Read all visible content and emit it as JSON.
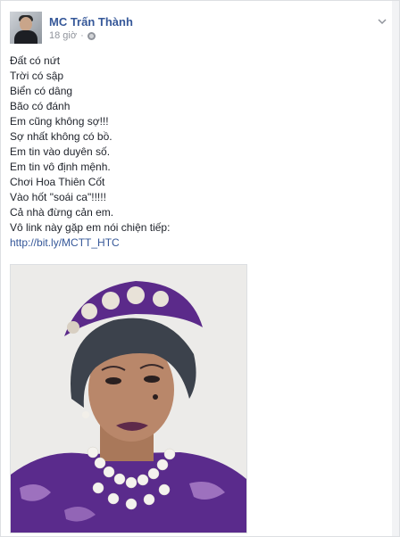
{
  "post": {
    "author": "MC Trấn Thành",
    "time": "18 giờ",
    "separator": "·",
    "lines": [
      "Đất có nứt",
      "Trời có sập",
      "Biển có dâng",
      "Bão có đánh",
      "Em cũng không sợ!!!",
      "Sợ nhất không có bồ.",
      "Em tin vào duyên số.",
      "Em tin vô định mệnh.",
      "Chơi Hoa Thiên Cốt",
      "Vào hốt \"soái ca\"!!!!!",
      "Cả nhà đừng cản em.",
      "Vô link này gặp em nói chiện tiếp:"
    ],
    "link": "http://bit.ly/MCTT_HTC"
  },
  "icons": {
    "privacy": "globe-icon",
    "menu": "chevron-down-icon"
  },
  "colors": {
    "name_link": "#365899",
    "text": "#1d2129",
    "meta": "#90949c",
    "background": "#e9ebee",
    "card": "#ffffff"
  }
}
